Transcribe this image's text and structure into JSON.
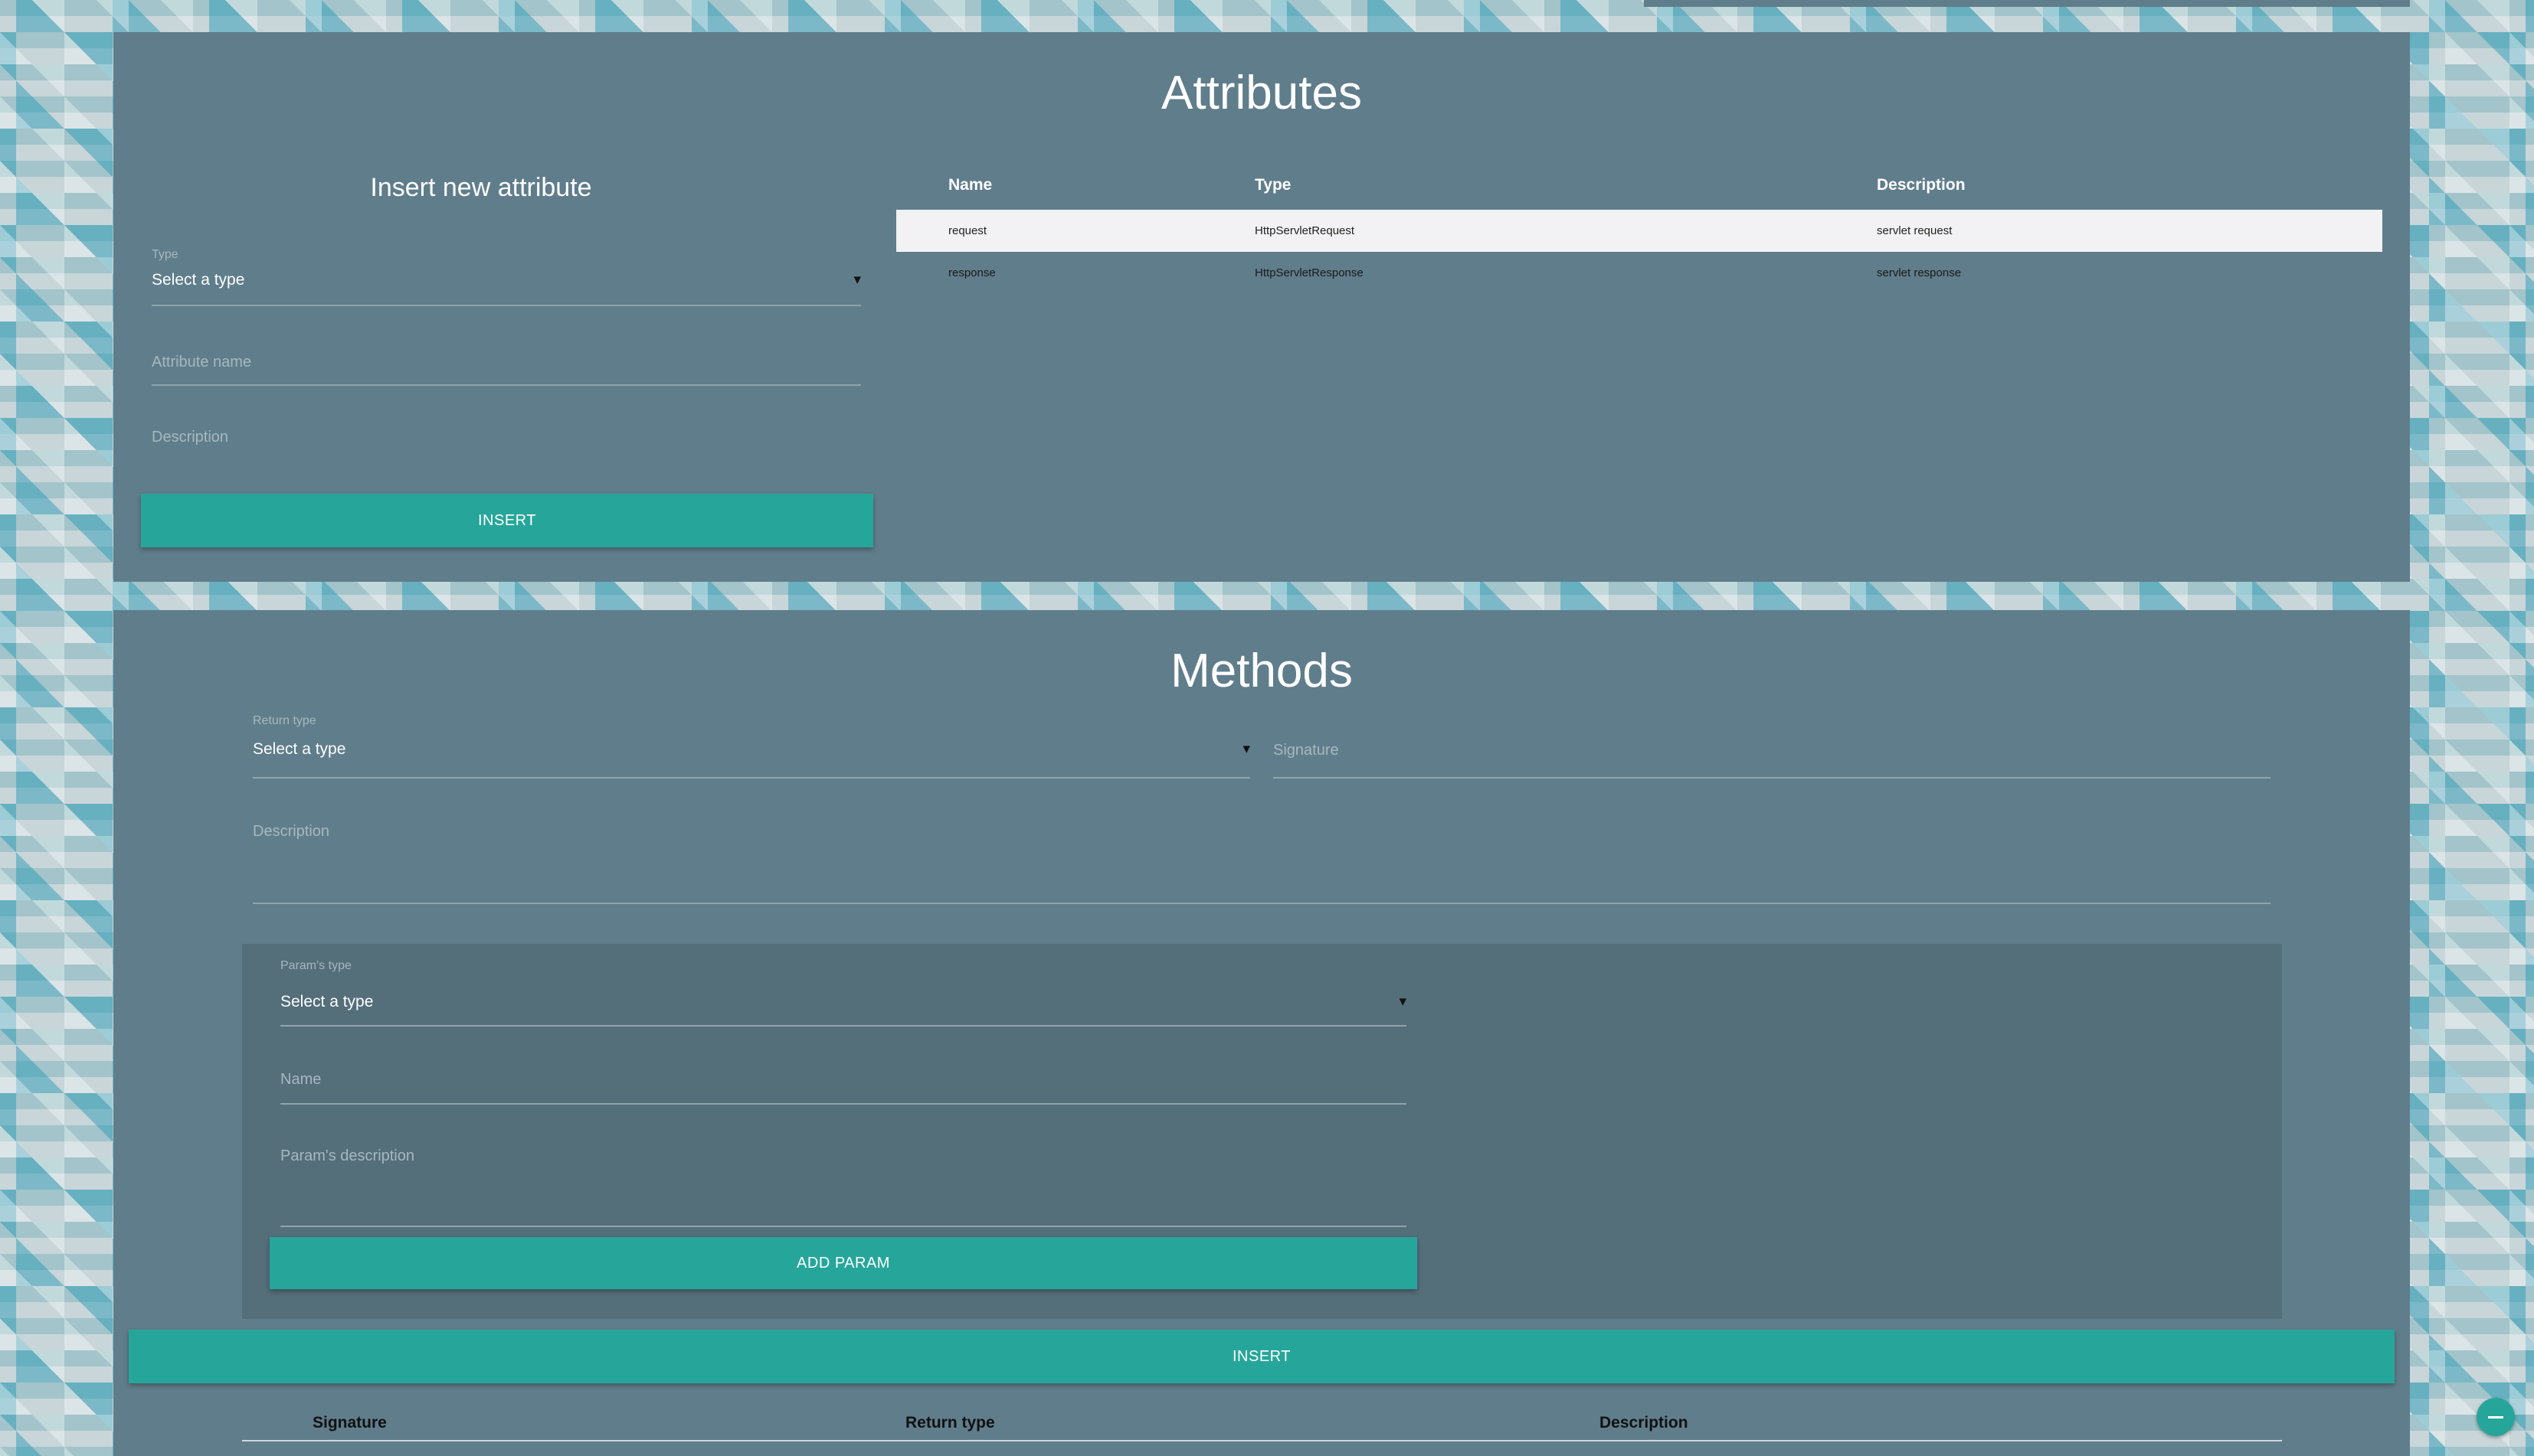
{
  "attributes": {
    "title": "Attributes",
    "form": {
      "title": "Insert new attribute",
      "type_label": "Type",
      "type_value": "Select a type",
      "name_placeholder": "Attribute name",
      "description_placeholder": "Description",
      "insert_label": "INSERT"
    },
    "table": {
      "headers": [
        "Name",
        "Type",
        "Description"
      ],
      "rows": [
        [
          "request",
          "HttpServletRequest",
          "servlet request"
        ],
        [
          "response",
          "HttpServletResponse",
          "servlet response"
        ]
      ]
    }
  },
  "methods": {
    "title": "Methods",
    "return_type_label": "Return type",
    "return_type_value": "Select a type",
    "signature_placeholder": "Signature",
    "description_placeholder": "Description",
    "param": {
      "type_label": "Param's type",
      "type_value": "Select a type",
      "name_placeholder": "Name",
      "description_placeholder": "Param's description",
      "add_label": "ADD PARAM"
    },
    "insert_label": "INSERT",
    "table_headers": [
      "Signature",
      "Return type",
      "Description"
    ]
  },
  "caret_glyph": "▾",
  "fab_icon": "minus-icon",
  "colors": {
    "panel": "#607d8b",
    "accent": "#26a69a",
    "param_box": "#546e7a"
  }
}
